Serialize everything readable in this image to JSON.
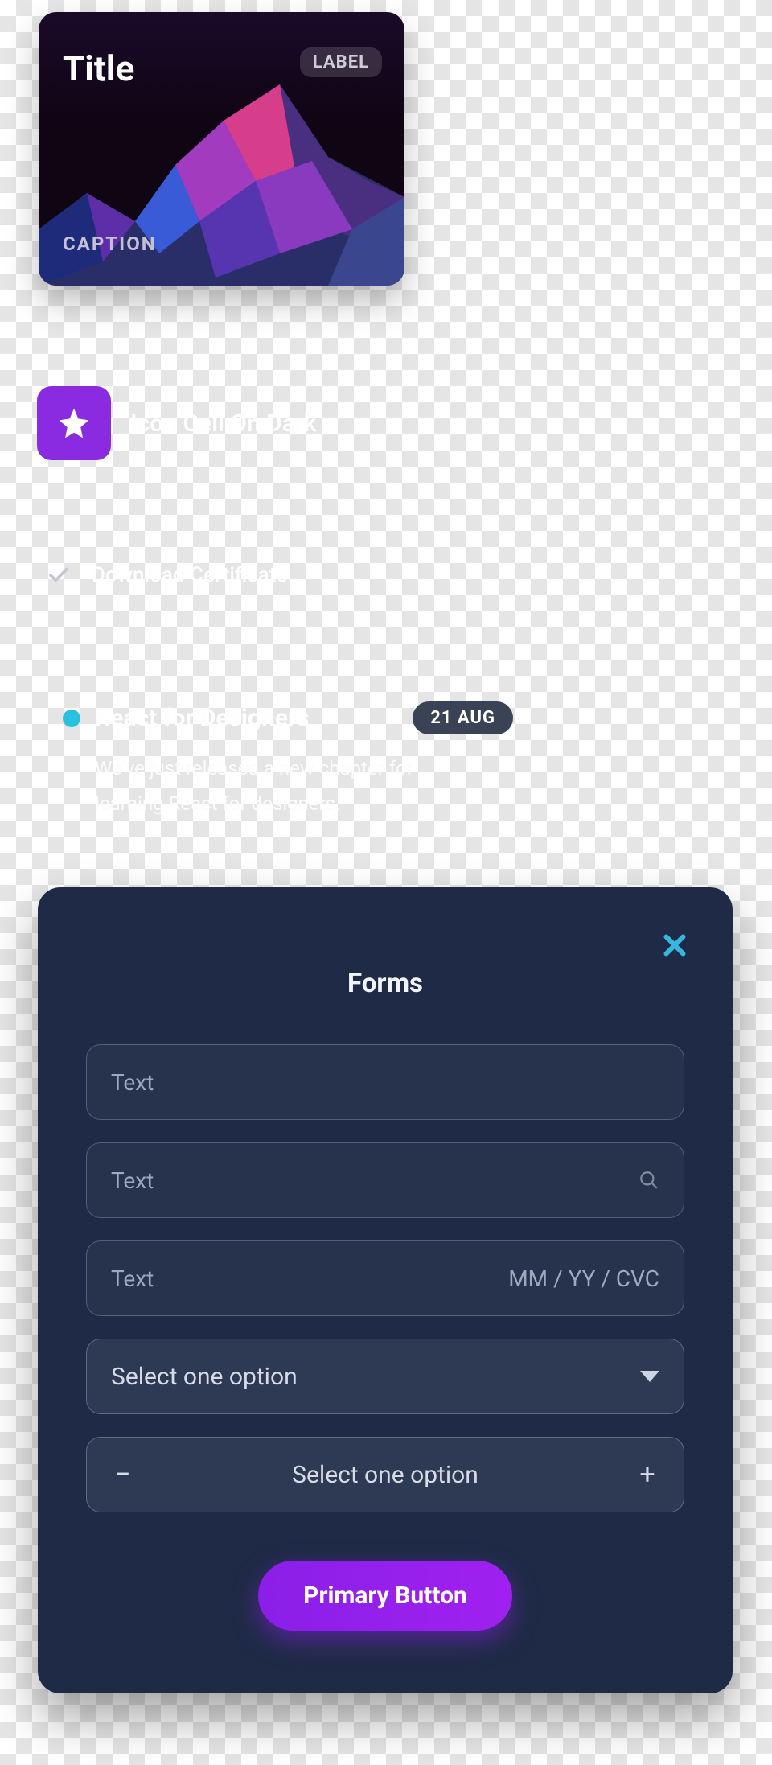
{
  "card": {
    "title": "Title",
    "label": "LABEL",
    "caption": "CAPTION"
  },
  "iconcell": {
    "title": "Icon Cell On Dark"
  },
  "download": {
    "label": "Download Certificate"
  },
  "react": {
    "title": "React for Designers",
    "date": "21 AUG",
    "description": "We've just released a new chapter for learning React for designers."
  },
  "forms": {
    "title": "Forms",
    "placeholders": {
      "text1": "Text",
      "text2": "Text",
      "text3": "Text",
      "card_hint": "MM / YY / CVC",
      "select1": "Select one option",
      "select2": "Select one option"
    },
    "primary_button": "Primary Button"
  }
}
